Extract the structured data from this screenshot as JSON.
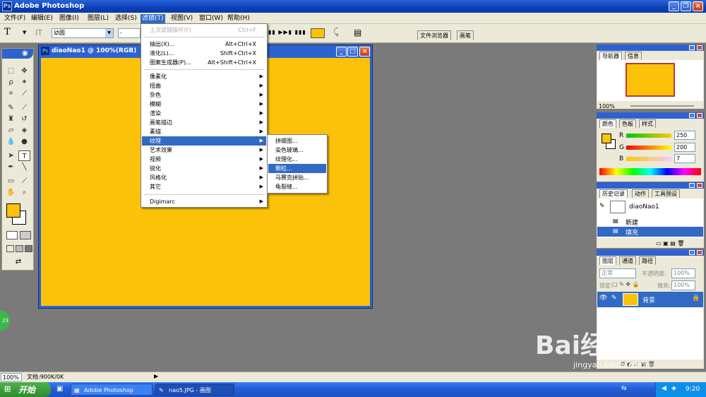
{
  "app": {
    "title": "Adobe Photoshop"
  },
  "menu": [
    "文件(F)",
    "编辑(E)",
    "图像(I)",
    "图层(L)",
    "选择(S)",
    "滤镜(T)",
    "视图(V)",
    "窗口(W)",
    "帮助(H)"
  ],
  "options": {
    "tool_label": "T",
    "font_family": "幼圆",
    "font_style": "-",
    "tab_files": "文件浏览器",
    "tab_brush": "画笔"
  },
  "document": {
    "title": "diaoNao1 @ 100%(RGB)",
    "fill_color": "#fcc20a"
  },
  "filter_menu": {
    "top": [
      {
        "label": "上次滤镜操作(F)",
        "shortcut": "Ctrl+F",
        "disabled": true
      }
    ],
    "group1": [
      {
        "label": "抽出(X)...",
        "shortcut": "Alt+Ctrl+X"
      },
      {
        "label": "液化(L)...",
        "shortcut": "Shift+Ctrl+X"
      },
      {
        "label": "图案生成器(P)...",
        "shortcut": "Alt+Shift+Ctrl+X"
      }
    ],
    "group2": [
      "像素化",
      "扭曲",
      "杂色",
      "模糊",
      "渲染",
      "画笔描边",
      "素描",
      "纹理",
      "艺术效果",
      "视频",
      "锐化",
      "风格化",
      "其它"
    ],
    "group3": [
      "Digimarc"
    ],
    "highlighted": "纹理"
  },
  "texture_submenu": {
    "items": [
      "拼缀图...",
      "染色玻璃...",
      "纹理化...",
      "颗粒...",
      "马赛克拼贴...",
      "龟裂缝..."
    ],
    "highlighted": "颗粒..."
  },
  "navigator": {
    "tabs": [
      "导航器",
      "信息"
    ],
    "zoom": "100%"
  },
  "color": {
    "tabs": [
      "颜色",
      "色板",
      "样式"
    ],
    "channels": [
      {
        "name": "R",
        "value": "250"
      },
      {
        "name": "G",
        "value": "200"
      },
      {
        "name": "B",
        "value": "7"
      }
    ]
  },
  "history": {
    "tabs": [
      "历史记录",
      "动作",
      "工具预设"
    ],
    "snapshot": "diaoNao1",
    "states": [
      "新建",
      "填充"
    ]
  },
  "layers": {
    "tabs": [
      "图层",
      "通道",
      "路径"
    ],
    "mode": "正常",
    "opacity_label": "不透明度:",
    "opacity": "100%",
    "lock_label": "锁定:",
    "fill_label": "填充:",
    "fill": "100%",
    "layer_name": "背景"
  },
  "status": {
    "zoom": "100%",
    "doc": "文档:900K/0K"
  },
  "taskbar": {
    "start": "开始",
    "tasks": [
      "Adobe Photoshop",
      "nao5.JPG - 画图"
    ],
    "time": "9:20"
  },
  "watermark": {
    "brand": "Bai经验",
    "url": "jingyan.baidu.com"
  },
  "badge": "23"
}
